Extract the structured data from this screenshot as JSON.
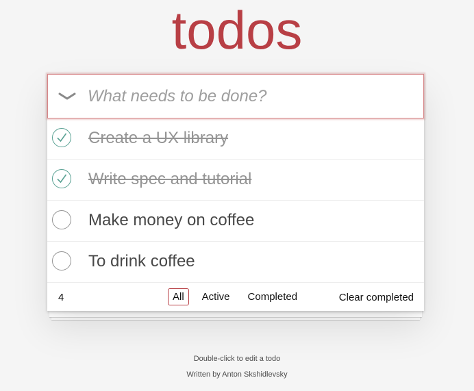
{
  "app": {
    "title": "todos"
  },
  "header": {
    "placeholder": "What needs to be done?"
  },
  "todos": [
    {
      "label": "Create a UX library",
      "completed": true
    },
    {
      "label": "Write spec and tutorial",
      "completed": true
    },
    {
      "label": "Make money on coffee",
      "completed": false
    },
    {
      "label": "To drink coffee",
      "completed": false
    }
  ],
  "footer": {
    "count": "4",
    "filters": [
      "All",
      "Active",
      "Completed"
    ],
    "selected_filter": "All",
    "clear_label": "Clear completed"
  },
  "info": {
    "line1": "Double-click to edit a todo",
    "line2": "Written by Anton Skshidlevsky"
  },
  "colors": {
    "brand": "#b83f45",
    "check": "#59a193",
    "background": "#f5f5f5"
  }
}
